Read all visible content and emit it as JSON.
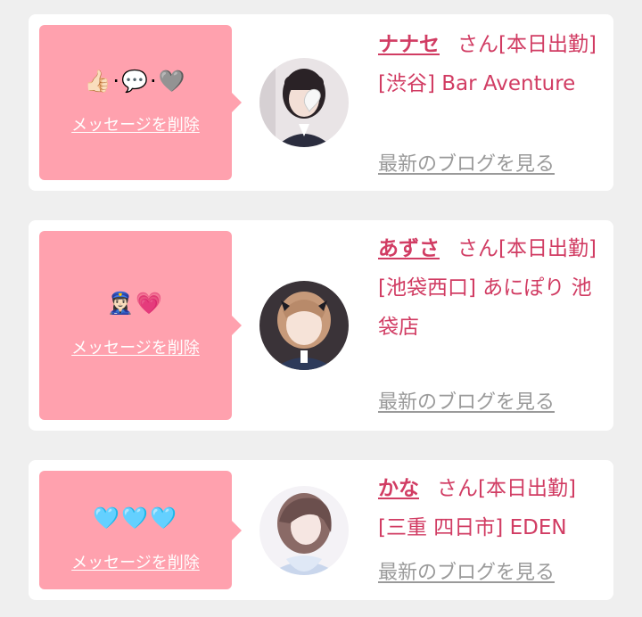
{
  "cards": [
    {
      "emoji": "👍🏻·💬·🩶",
      "delete_label": "メッセージを削除",
      "name": "ナナセ",
      "status": "さん[本日出勤]",
      "area": "[渋谷]",
      "shop": "Bar Aventure",
      "blog_label": "最新のブログを見る"
    },
    {
      "emoji": "👮🏻‍♀️💗",
      "delete_label": "メッセージを削除",
      "name": "あずさ",
      "status": "さん[本日出勤]",
      "area": "[池袋西口]",
      "shop": "あにぽり 池袋店",
      "blog_label": "最新のブログを見る"
    },
    {
      "emoji": "🩵🩵🩵",
      "delete_label": "メッセージを削除",
      "name": "かな",
      "status": "さん[本日出勤]",
      "area": "[三重 四日市]",
      "shop": "EDEN",
      "blog_label": "最新のブログを見る"
    }
  ],
  "colors": {
    "page_background": "#efefef",
    "card_background": "#ffffff",
    "message_bubble": "#ffa1ae",
    "accent_text": "#d13c63",
    "muted_link": "#9a9a9a"
  }
}
